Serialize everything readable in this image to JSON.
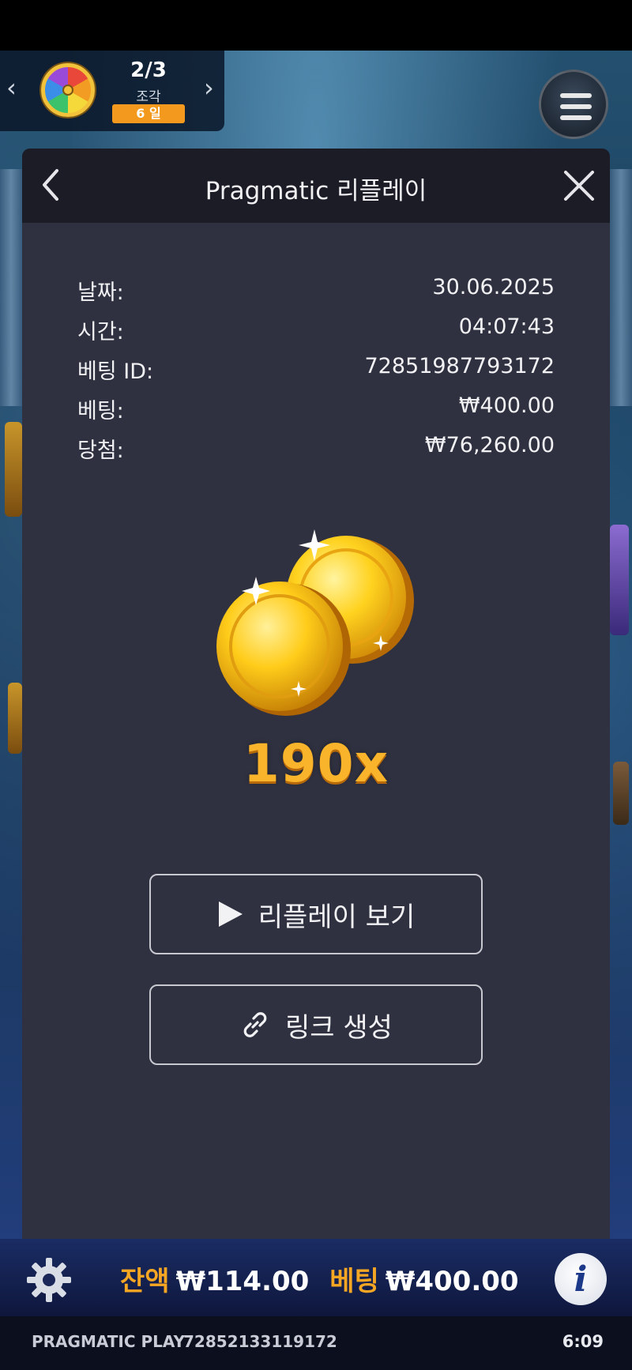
{
  "progress_widget": {
    "count": "2/3",
    "piece_label": "조각",
    "days_badge": "6 일"
  },
  "replay_panel": {
    "title": "Pragmatic 리플레이",
    "details": [
      {
        "label": "날짜:",
        "value": "30.06.2025"
      },
      {
        "label": "시간:",
        "value": "04:07:43"
      },
      {
        "label": "베팅 ID:",
        "value": "72851987793172"
      },
      {
        "label": "베팅:",
        "value": "₩400.00"
      },
      {
        "label": "당첨:",
        "value": "₩76,260.00"
      }
    ],
    "multiplier": "190x",
    "watch_replay_label": "리플레이 보기",
    "create_link_label": "링크 생성"
  },
  "bottom_bar": {
    "balance_label": "잔액",
    "balance_value": "₩114.00",
    "bet_label": "베팅",
    "bet_value": "₩400.00"
  },
  "footer": {
    "brand": "PRAGMATIC PLAY",
    "round_id": "72852133119172",
    "time": "6:09"
  },
  "colors": {
    "panel_bg": "#2f3140",
    "header_bg": "#1b1c26",
    "accent_orange": "#f5a623",
    "multiplier_gold": "#f9b42b"
  },
  "icons": {
    "back": "chevron-left-icon",
    "close": "close-icon",
    "menu": "hamburger-menu-icon",
    "play": "play-icon",
    "link": "link-icon",
    "settings": "gear-icon",
    "info": "info-icon",
    "coins": "gold-coins-icon",
    "wheel": "prize-wheel-icon"
  }
}
